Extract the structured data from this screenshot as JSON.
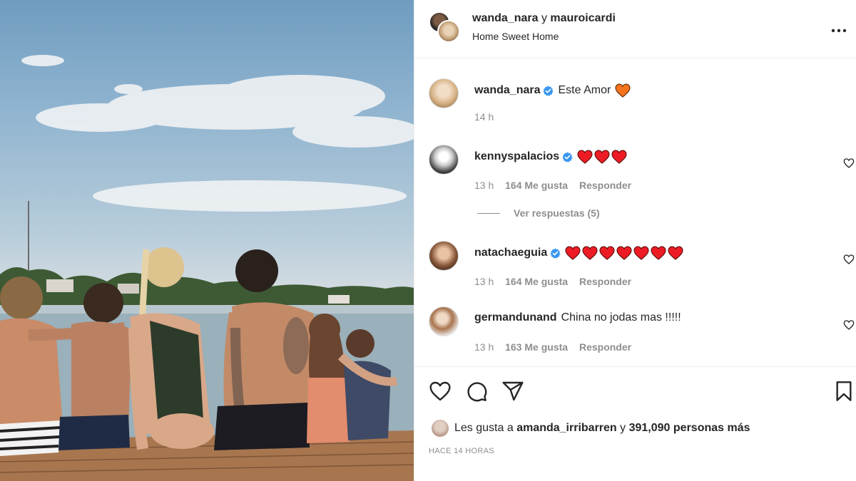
{
  "post": {
    "author_1": "wanda_nara",
    "conjunction": "y",
    "author_2": "mauroicardi",
    "location": "Home Sweet Home",
    "more_icon": "more-horizontal-icon"
  },
  "caption": {
    "user": "wanda_nara",
    "verified": true,
    "text": "Este Amor",
    "emoji": "orange-heart",
    "time": "14 h"
  },
  "comments": [
    {
      "user": "kennyspalacios",
      "verified": true,
      "text": "",
      "hearts": 3,
      "time": "13 h",
      "likes": "164 Me gusta",
      "reply": "Responder"
    },
    {
      "user": "natachaeguia",
      "verified": true,
      "text": "",
      "hearts": 7,
      "time": "13 h",
      "likes": "164 Me gusta",
      "reply": "Responder"
    },
    {
      "user": "germandunand",
      "verified": false,
      "text": "China no jodas mas !!!!!",
      "hearts": 0,
      "time": "13 h",
      "likes": "163 Me gusta",
      "reply": "Responder"
    }
  ],
  "view_replies": "Ver respuestas (5)",
  "likes": {
    "prefix": "Les gusta a",
    "user": "amanda_irribarren",
    "middle": "y",
    "count": "391,090 personas más"
  },
  "timestamp": "HACE 14 HORAS",
  "colors": {
    "verified": "#3897f0",
    "red_heart": "#ed1c24",
    "orange_heart": "#f4731c",
    "meta_text": "#8e8e8e"
  }
}
